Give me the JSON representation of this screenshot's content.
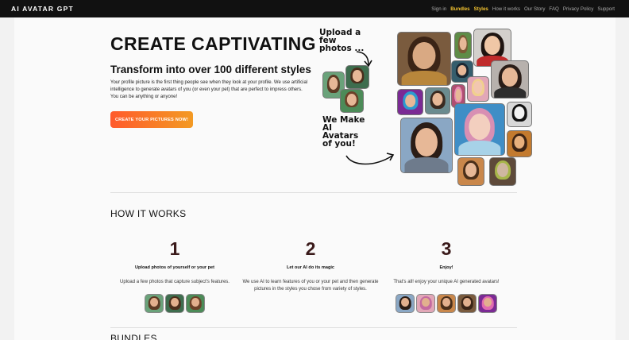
{
  "header": {
    "brand": "AI AVATAR GPT",
    "nav": [
      {
        "label": "Sign in",
        "highlight": false
      },
      {
        "label": "Bundles",
        "highlight": true
      },
      {
        "label": "Styles",
        "highlight": true
      },
      {
        "label": "How it works",
        "highlight": false
      },
      {
        "label": "Our Story",
        "highlight": false
      },
      {
        "label": "FAQ",
        "highlight": false
      },
      {
        "label": "Privacy Policy",
        "highlight": false
      },
      {
        "label": "Support",
        "highlight": false
      }
    ]
  },
  "hero": {
    "title": "CREATE CAPTIVATING",
    "subtitle": "Transform into over 100 different styles",
    "description": "Your profile picture is the first thing people see when they look at your profile. We use artificial intelligence to generate avatars of you (or even your pet) that are perfect to impress others. You can be anything or anyone!",
    "cta_label": "CREATE YOUR PICTURES NOW!",
    "collage_text_upload": "Upload a few photos ...",
    "collage_text_make": "We Make AI Avatars of you!"
  },
  "how": {
    "title": "HOW IT WORKS",
    "steps": [
      {
        "number": "1",
        "title": "Upload photos of yourself or your pet",
        "desc": "Upload a few photos that capture subject's features."
      },
      {
        "number": "2",
        "title": "Let our AI do its magic",
        "desc": "We use AI to learn features of you or your pet and then generate pictures in the styles you chose from variety of styles."
      },
      {
        "number": "3",
        "title": "Enjoy!",
        "desc": "That's all! enjoy your unique AI generated avatars!"
      }
    ]
  },
  "bundles": {
    "title": "BUNDLES"
  },
  "colors": {
    "accent": "#f4c430",
    "cta_start": "#ff5a2c",
    "cta_end": "#f39a23",
    "topbar": "#111111"
  }
}
